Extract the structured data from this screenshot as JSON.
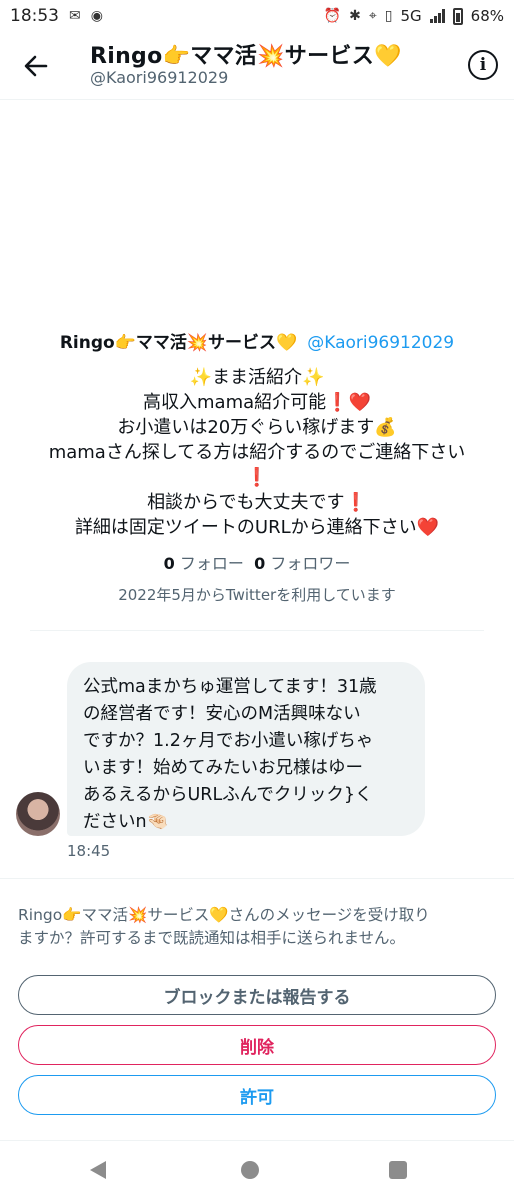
{
  "status_bar": {
    "time": "18:53",
    "network": "5G",
    "battery": "68%"
  },
  "header": {
    "title": "Ringo👉ママ活💥サービス💛",
    "handle": "@Kaori96912029"
  },
  "profile": {
    "name": "Ringo👉ママ活💥サービス💛",
    "handle": "@Kaori96912029",
    "bio_lines": [
      "✨まま活紹介✨",
      "高収入mama紹介可能❗❤️",
      "お小遣いは20万ぐらい稼げます💰",
      "mamaさん探してる方は紹介するのでご連絡下さい",
      "❗",
      "相談からでも大丈夫です❗",
      "詳細は固定ツイートのURLから連絡下さい❤️"
    ],
    "following_count": "0",
    "following_label": "フォロー",
    "followers_count": "0",
    "followers_label": "フォロワー",
    "joined": "2022年5月からTwitterを利用しています"
  },
  "message": {
    "lines": [
      "公式maまかちゅ運営してます！31歳",
      "の経営者です！安心のM活興味ない",
      "ですか？1.2ヶ月でお小遣い稼げちゃ",
      "います！始めてみたいお兄様はゆー",
      "あるえるからURLふんでクリック}く",
      "ださいn🤏🏻"
    ],
    "time": "18:45"
  },
  "request": {
    "lines": [
      "Ringo👉ママ活💥サービス💛さんのメッセージを受け取り",
      "ますか？許可するまで既読通知は相手に送られません。"
    ],
    "block_label": "ブロックまたは報告する",
    "delete_label": "削除",
    "allow_label": "許可"
  },
  "icons": {
    "back": "back-arrow-icon",
    "info": "info-icon",
    "nav_back": "nav-back-icon",
    "nav_home": "nav-home-icon",
    "nav_recent": "nav-recent-icon"
  },
  "colors": {
    "accent": "#1d9bf0",
    "danger": "#e0245e",
    "secondary_text": "#536471",
    "bubble": "#eff3f4"
  }
}
